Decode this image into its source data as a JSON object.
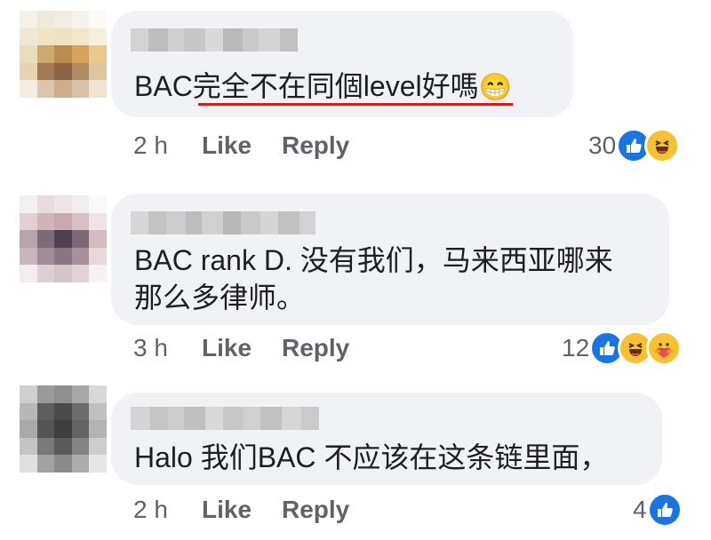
{
  "colors": {
    "bubble": "#f0f2f5",
    "accent_like": "#1b74e4",
    "emoji": "#f7c12f",
    "underline": "#e4161a"
  },
  "comments": [
    {
      "text": "BAC完全不在同個level好嗎",
      "emoji": "😁",
      "time": "2 h",
      "like_label": "Like",
      "reply_label": "Reply",
      "reaction_count": "30",
      "reactions": [
        "like-icon",
        "haha-icon"
      ]
    },
    {
      "text_line1": "BAC rank D. 没有我们，马来西亚哪来",
      "text_line2": "那么多律师。",
      "time": "3 h",
      "like_label": "Like",
      "reply_label": "Reply",
      "reaction_count": "12",
      "reactions": [
        "like-icon",
        "haha-icon",
        "care-icon"
      ]
    },
    {
      "text": "Halo 我们BAC 不应该在这条链里面，",
      "time": "2 h",
      "like_label": "Like",
      "reply_label": "Reply",
      "reaction_count": "4",
      "reactions": [
        "like-icon"
      ]
    }
  ]
}
